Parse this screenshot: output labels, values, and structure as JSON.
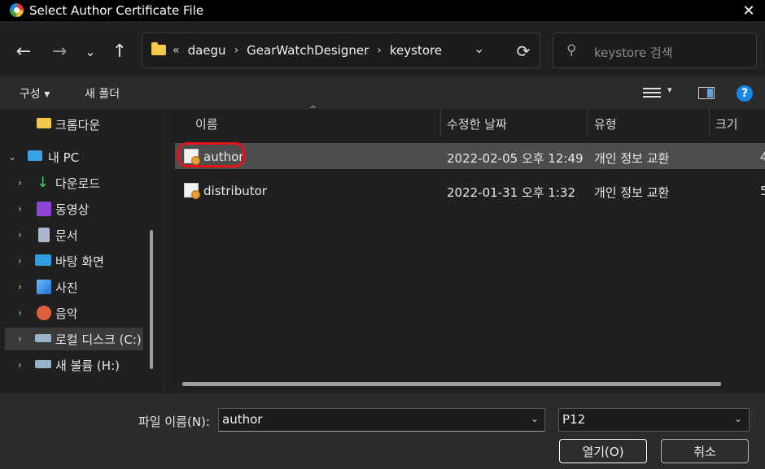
{
  "window": {
    "title": "Select Author Certificate File",
    "close_glyph": "✕"
  },
  "nav": {
    "back_glyph": "←",
    "forward_glyph": "→",
    "recent_glyph": "⌄",
    "up_glyph": "↑",
    "breadcrumb_overflow": "«",
    "breadcrumbs": [
      "daegu",
      "GearWatchDesigner",
      "keystore"
    ],
    "crumb_sep": "›",
    "dropdown_glyph": "⌄",
    "refresh_glyph": "⟳",
    "search_placeholder": "keystore 검색"
  },
  "toolbar": {
    "organize_label": "구성 ▾",
    "new_folder_label": "새 폴더",
    "view_dd_glyph": "▾",
    "help_glyph": "?"
  },
  "sidebar": {
    "items": [
      {
        "label": "크롬다운",
        "icon": "folder-icon",
        "color": "#f5c84c",
        "expandable": false
      },
      {
        "label": "내 PC",
        "icon": "computer-icon",
        "color": "#3aa0e8",
        "expandable": true,
        "expanded": true
      },
      {
        "label": "다운로드",
        "icon": "download-icon",
        "color": "#3cc46a",
        "expandable": true
      },
      {
        "label": "동영상",
        "icon": "video-icon",
        "color": "#8e44d8",
        "expandable": true
      },
      {
        "label": "문서",
        "icon": "document-icon",
        "color": "#a9b8cc",
        "expandable": true
      },
      {
        "label": "바탕 화면",
        "icon": "desktop-icon",
        "color": "#2f9fe0",
        "expandable": true
      },
      {
        "label": "사진",
        "icon": "pictures-icon",
        "color": "#3a8fe0",
        "expandable": true
      },
      {
        "label": "음악",
        "icon": "music-icon",
        "color": "#e0603c",
        "expandable": true
      },
      {
        "label": "로컬 디스크 (C:)",
        "icon": "drive-icon",
        "color": "#9ab3c8",
        "expandable": true,
        "selected": true
      },
      {
        "label": "새 볼륨 (H:)",
        "icon": "drive-icon",
        "color": "#9ab3c8",
        "expandable": true
      }
    ],
    "chevron_right": "›",
    "chevron_down": "⌄"
  },
  "columns": [
    "이름",
    "수정한 날짜",
    "유형",
    "크기"
  ],
  "sort_glyph": "^",
  "files": [
    {
      "name": "author",
      "modified": "2022-02-05 오후 12:49",
      "type": "개인 정보 교환",
      "size": "4",
      "selected": true,
      "icon": "certificate-icon"
    },
    {
      "name": "distributor",
      "modified": "2022-01-31 오후 1:32",
      "type": "개인 정보 교환",
      "size": "5",
      "selected": false,
      "icon": "certificate-icon"
    }
  ],
  "bottom": {
    "filename_label": "파일 이름(N):",
    "filename_value": "author",
    "filetype_value": "P12",
    "dd_glyph": "⌄",
    "open_label": "열기(O)",
    "cancel_label": "취소"
  },
  "colors": {
    "accent": "#1a86e8",
    "highlight_ring": "#e3141c",
    "selection": "#4d4d4d"
  }
}
